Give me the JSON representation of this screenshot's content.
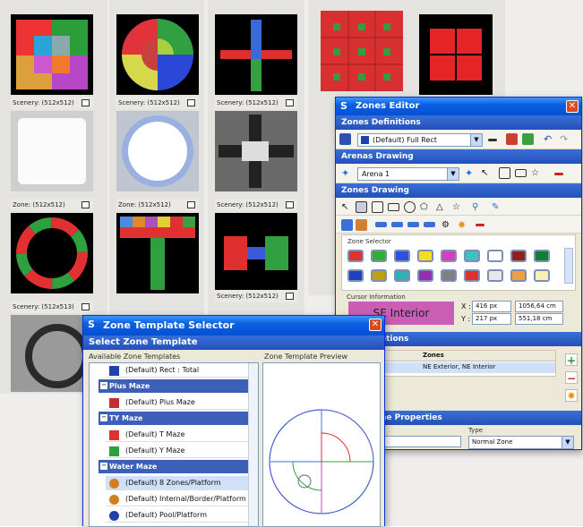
{
  "gallery": {
    "captions": {
      "c1": "Scenery: (512x512)",
      "c2": "Scenery: (512x512)",
      "c3": "Scenery: (512x512)",
      "c4": "Zone: (512x512)",
      "c5": "Zone: (512x512)",
      "c6": "Scenery: (512x512)",
      "c7": "Scenery: (512x513)",
      "c8": "Zone: (512x512)",
      "c9": "Scenery: (512x512)",
      "c10": "Zone: (512x512)"
    }
  },
  "zones_editor": {
    "title": "Zones Editor",
    "sec_defs": "Zones Definitions",
    "def_select": "(Default) Full Rect",
    "sec_arenas": "Arenas Drawing",
    "arena_select": "Arena 1",
    "sec_zdraw": "Zones Drawing",
    "zone_selector": "Zone Selector",
    "cursor_info": "Cursor Information",
    "cursor_zone": "SE Interior",
    "x_label": "X :",
    "x_px": "416 px",
    "x_cm": "1056,64 cm",
    "y_label": "Y :",
    "y_px": "217 px",
    "y_cm": "551,18 cm",
    "sec_combinations": "ations",
    "col_zones": "Zones",
    "row_name": "nt",
    "row_zones": "NE Exterior, NE Interior",
    "sec_props": "ne Properties",
    "type_label": "Type",
    "type_value": "Normal Zone",
    "swatches_row1": [
      "#e03030",
      "#30b030",
      "#3050e0",
      "#f0e020",
      "#d040c0",
      "#40c0c0",
      "#ffffff",
      "#902020",
      "#108030"
    ],
    "swatches_row2": [
      "#2040c0",
      "#c0a010",
      "#30b0b0",
      "#9030b0",
      "#808080",
      "#e03030",
      "#e8e8e8",
      "#f0a040",
      "#f8f0b0"
    ]
  },
  "template_selector": {
    "title": "Zone Template Selector",
    "heading": "Select Zone Template",
    "left_label": "Available Zone Templates",
    "right_label": "Zone Template Preview",
    "items": [
      {
        "type": "item",
        "label": "(Default) Rect : Total",
        "icon": "rect-icon"
      },
      {
        "type": "cat",
        "label": "Plus Maze"
      },
      {
        "type": "item",
        "label": "(Default) Plus Maze",
        "icon": "plus-maze-icon"
      },
      {
        "type": "cat",
        "label": "TY Maze"
      },
      {
        "type": "item",
        "label": "(Default) T Maze",
        "icon": "t-maze-icon"
      },
      {
        "type": "item",
        "label": "(Default) Y Maze",
        "icon": "y-maze-icon"
      },
      {
        "type": "cat",
        "label": "Water Maze"
      },
      {
        "type": "item",
        "label": "(Default) 8 Zones/Platform",
        "icon": "water-maze-icon"
      },
      {
        "type": "item",
        "label": "(Default) Internal/Border/Platform",
        "icon": "water-maze-icon"
      },
      {
        "type": "item",
        "label": "(Default) Pool/Platform",
        "icon": "pool-icon"
      }
    ]
  }
}
